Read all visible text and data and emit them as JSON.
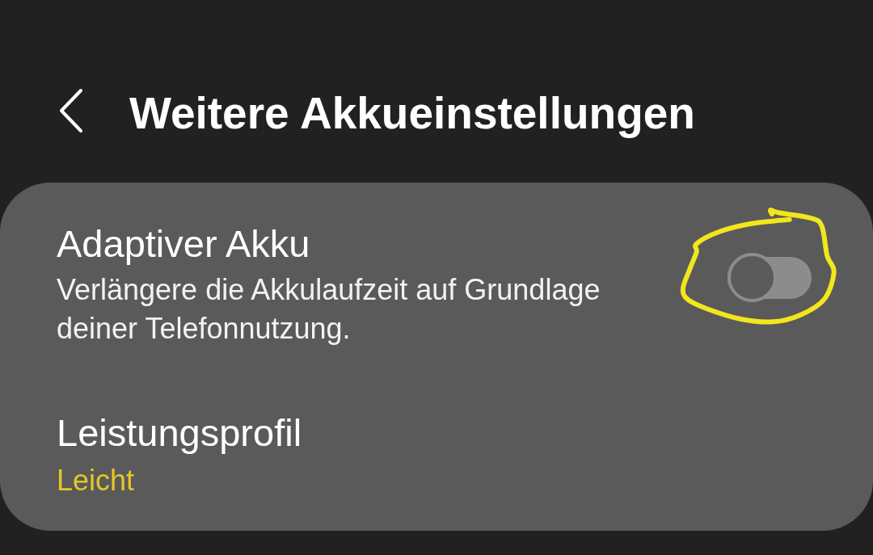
{
  "header": {
    "title": "Weitere Akkueinstellungen"
  },
  "settings": [
    {
      "kind": "switch",
      "title": "Adaptiver Akku",
      "description": "Verlängere die Akkulaufzeit auf Grundlage deiner Telefonnutzung.",
      "on": false
    },
    {
      "kind": "value",
      "title": "Leistungsprofil",
      "value": "Leicht"
    }
  ],
  "annotation": {
    "kind": "circle"
  }
}
